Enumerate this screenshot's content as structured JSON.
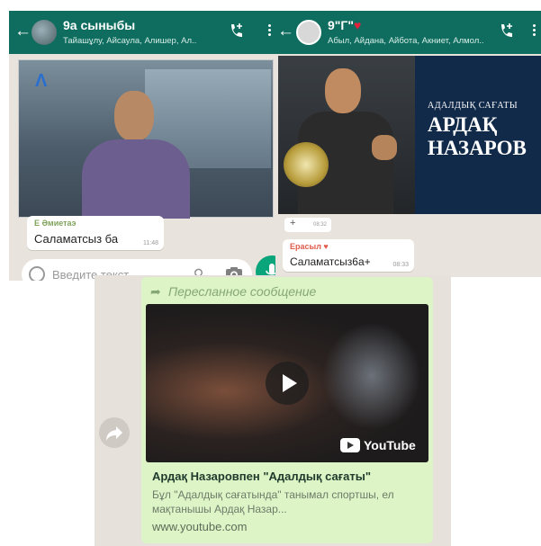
{
  "left_chat": {
    "title": "9а сыныбы",
    "participants": "Тайашұлу, Айсаула, Алишер, Ал..",
    "message": {
      "sender": "Е Әмиетаэ",
      "text": "Саламатсыз ба",
      "time": "11:48"
    },
    "input_placeholder": "Введите текст"
  },
  "right_chat": {
    "title": "9\"Г\"",
    "title_heart": "♥",
    "participants": "Абыл, Айдана, Айбота, Акниет, Алмол..",
    "video": {
      "line1": "АДАЛДЫҚ САҒАТЫ",
      "line2": "АРДАҚ",
      "line3": "НАЗАРОВ"
    },
    "reaction": "+",
    "reaction_time": "08:32",
    "message": {
      "sender": "Ерасыл ♥",
      "text": "Саламатсыз6а+",
      "time": "08:33"
    }
  },
  "forwarded": {
    "label": "Пересланное сообщение",
    "video_brand": "YouTube",
    "link_title": "Ардақ Назаровпен \"Адалдық сағаты\"",
    "link_description": "Бұл \"Адалдық сағатында\" танымал спортшы, ел мақтанышы Ардақ Назар...",
    "link_url": "www.youtube.com"
  },
  "colors": {
    "header": "#0f6d5f",
    "chat_bg": "#e8e3dc",
    "outgoing_bubble": "#dcf4c6",
    "mic_button": "#0aa57a"
  }
}
